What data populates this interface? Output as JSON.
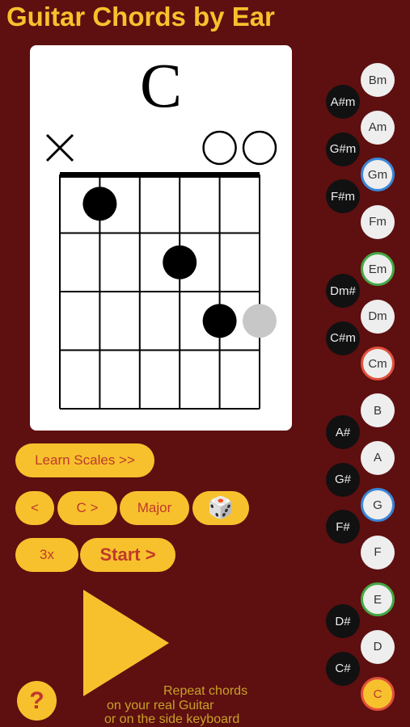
{
  "app": {
    "title": "Guitar Chords by Ear"
  },
  "chord_diagram": {
    "name": "C",
    "string_markers": [
      "x",
      "",
      "",
      "",
      "o",
      "o"
    ],
    "finger_positions": [
      {
        "string": 2,
        "fret": 1
      },
      {
        "string": 4,
        "fret": 2
      },
      {
        "string": 5,
        "fret": 3
      }
    ],
    "optional_positions": [
      {
        "string": 6,
        "fret": 3
      }
    ],
    "frets_shown": 4,
    "strings": 6
  },
  "buttons": {
    "learn_scales": "Learn Scales >>",
    "prev": "<",
    "key_next": "C >",
    "mode": "Major",
    "random": "🎲",
    "repeat": "3x",
    "start": "Start >"
  },
  "help": {
    "label": "?"
  },
  "hint": {
    "line1": "Repeat chords",
    "line2": "on your real Guitar",
    "line3": "or on the side keyboard"
  },
  "keyboard": {
    "minor_keys": [
      {
        "label": "Bm",
        "color": "white",
        "ring": ""
      },
      {
        "label": "A#m",
        "color": "black",
        "ring": ""
      },
      {
        "label": "Am",
        "color": "white",
        "ring": ""
      },
      {
        "label": "G#m",
        "color": "black",
        "ring": ""
      },
      {
        "label": "Gm",
        "color": "white",
        "ring": "blue"
      },
      {
        "label": "F#m",
        "color": "black",
        "ring": ""
      },
      {
        "label": "Fm",
        "color": "white",
        "ring": ""
      },
      {
        "label": "Em",
        "color": "white",
        "ring": "green"
      },
      {
        "label": "Dm#",
        "color": "black",
        "ring": ""
      },
      {
        "label": "Dm",
        "color": "white",
        "ring": ""
      },
      {
        "label": "C#m",
        "color": "black",
        "ring": ""
      },
      {
        "label": "Cm",
        "color": "white",
        "ring": "red"
      }
    ],
    "major_keys": [
      {
        "label": "B",
        "color": "white",
        "ring": ""
      },
      {
        "label": "A#",
        "color": "black",
        "ring": ""
      },
      {
        "label": "A",
        "color": "white",
        "ring": ""
      },
      {
        "label": "G#",
        "color": "black",
        "ring": ""
      },
      {
        "label": "G",
        "color": "white",
        "ring": "blue"
      },
      {
        "label": "F#",
        "color": "black",
        "ring": ""
      },
      {
        "label": "F",
        "color": "white",
        "ring": ""
      },
      {
        "label": "E",
        "color": "white",
        "ring": "green"
      },
      {
        "label": "D#",
        "color": "black",
        "ring": ""
      },
      {
        "label": "D",
        "color": "white",
        "ring": ""
      },
      {
        "label": "C#",
        "color": "black",
        "ring": ""
      },
      {
        "label": "C",
        "color": "white",
        "ring": "active"
      }
    ]
  },
  "colors": {
    "background": "#5e0f10",
    "accent": "#f7c12d",
    "accent_text": "#c0392b"
  }
}
